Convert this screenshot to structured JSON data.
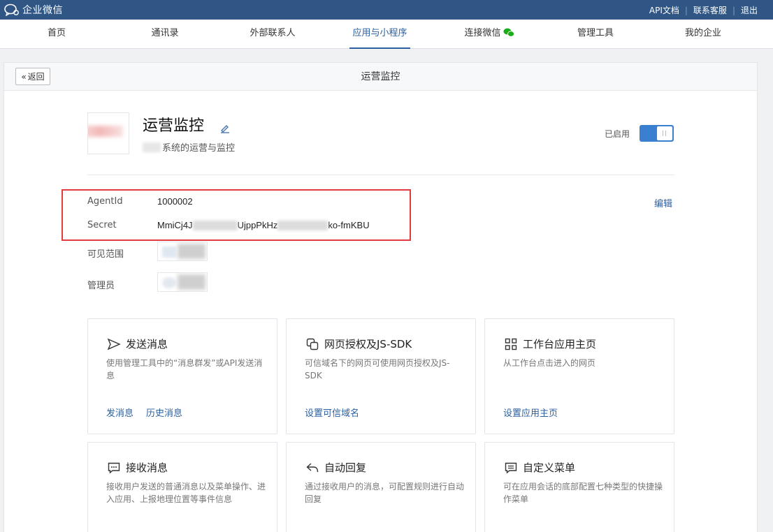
{
  "topbar": {
    "logo_text": "企业微信",
    "links": [
      "API文档",
      "联系客服",
      "退出"
    ]
  },
  "nav": {
    "items": [
      "首页",
      "通讯录",
      "外部联系人",
      "应用与小程序",
      "连接微信",
      "管理工具",
      "我的企业"
    ],
    "active": "应用与小程序"
  },
  "panel": {
    "back_label": "返回",
    "title": "运营监控"
  },
  "app": {
    "name": "运营监控",
    "desc_suffix": "系统的运营与监控",
    "status_label": "已启用",
    "enabled": true
  },
  "info": {
    "agentid_label": "AgentId",
    "agentid_value": "1000002",
    "secret_label": "Secret",
    "secret_part1": "MmiCj4J",
    "secret_part2": "UjppPkHz",
    "secret_part3": "ko-fmKBU",
    "edit_label": "编辑",
    "visible_label": "可见范围",
    "admin_label": "管理员"
  },
  "cards": [
    {
      "title": "发送消息",
      "desc": "使用管理工具中的“消息群发”或API发送消息",
      "links": [
        "发消息",
        "历史消息"
      ]
    },
    {
      "title": "网页授权及JS-SDK",
      "desc": "可信域名下的网页可使用网页授权及JS-SDK",
      "links": [
        "设置可信域名"
      ]
    },
    {
      "title": "工作台应用主页",
      "desc": "从工作台点击进入的网页",
      "links": [
        "设置应用主页"
      ]
    },
    {
      "title": "接收消息",
      "desc": "接收用户发送的普通消息以及菜单操作、进入应用、上报地理位置等事件信息",
      "links": []
    },
    {
      "title": "自动回复",
      "desc": "通过接收用户的消息，可配置规则进行自动回复",
      "links": []
    },
    {
      "title": "自定义菜单",
      "desc": "可在应用会话的底部配置七种类型的快捷操作菜单",
      "links": []
    }
  ],
  "colors": {
    "topbar": "#2f5685",
    "accent": "#2b5fa0",
    "toggle": "#3a7fd0",
    "highlight": "#e23b3b",
    "wechat_green": "#1aad19"
  }
}
